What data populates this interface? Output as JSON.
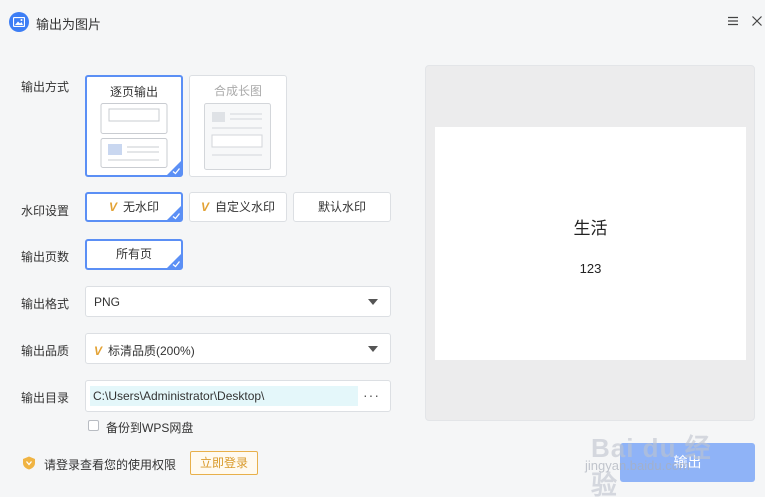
{
  "window": {
    "title": "输出为图片"
  },
  "labels": {
    "output_mode": "输出方式",
    "watermark": "水印设置",
    "pages": "输出页数",
    "format": "输出格式",
    "quality": "输出品质",
    "directory": "输出目录"
  },
  "output_mode": {
    "options": [
      "逐页输出",
      "合成长图"
    ],
    "selected": "逐页输出"
  },
  "watermark": {
    "options": [
      "无水印",
      "自定义水印",
      "默认水印"
    ],
    "selected": "无水印"
  },
  "pages": {
    "selected": "所有页"
  },
  "format": {
    "value": "PNG"
  },
  "quality": {
    "value": "标清品质(200%)"
  },
  "directory": {
    "value": "C:\\Users\\Administrator\\Desktop\\",
    "more": "···"
  },
  "backup": {
    "label": "备份到WPS网盘",
    "checked": false
  },
  "login": {
    "hint": "请登录查看您的使用权限",
    "button": "立即登录"
  },
  "preview": {
    "title": "生活",
    "text": "123"
  },
  "export_button": "输出",
  "overlay_watermark": {
    "brand": "Bai du 经验",
    "site": "jingyan.baidu.com"
  },
  "colors": {
    "accent": "#5b8ff5",
    "export": "#8fb3f7",
    "vip": "#e3a234"
  }
}
